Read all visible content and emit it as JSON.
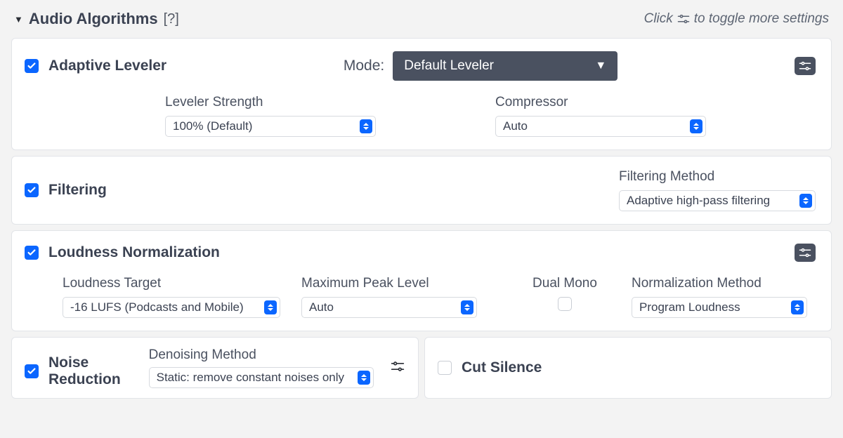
{
  "header": {
    "title": "Audio Algorithms",
    "help": "[?]",
    "hint_prefix": "Click",
    "hint_suffix": "to toggle more settings"
  },
  "leveler": {
    "checked": true,
    "title": "Adaptive Leveler",
    "mode_label": "Mode:",
    "mode_value": "Default Leveler",
    "fields": {
      "strength_label": "Leveler Strength",
      "strength_value": "100% (Default)",
      "compressor_label": "Compressor",
      "compressor_value": "Auto"
    }
  },
  "filtering": {
    "checked": true,
    "title": "Filtering",
    "method_label": "Filtering Method",
    "method_value": "Adaptive high-pass filtering"
  },
  "normalization": {
    "checked": true,
    "title": "Loudness Normalization",
    "fields": {
      "target_label": "Loudness Target",
      "target_value": "-16 LUFS (Podcasts and Mobile)",
      "peak_label": "Maximum Peak Level",
      "peak_value": "Auto",
      "dualmono_label": "Dual Mono",
      "dualmono_checked": false,
      "method_label": "Normalization Method",
      "method_value": "Program Loudness"
    }
  },
  "noise": {
    "checked": true,
    "title": "Noise Reduction",
    "method_label": "Denoising Method",
    "method_value": "Static: remove constant noises only"
  },
  "cutsilence": {
    "checked": false,
    "title": "Cut Silence"
  }
}
